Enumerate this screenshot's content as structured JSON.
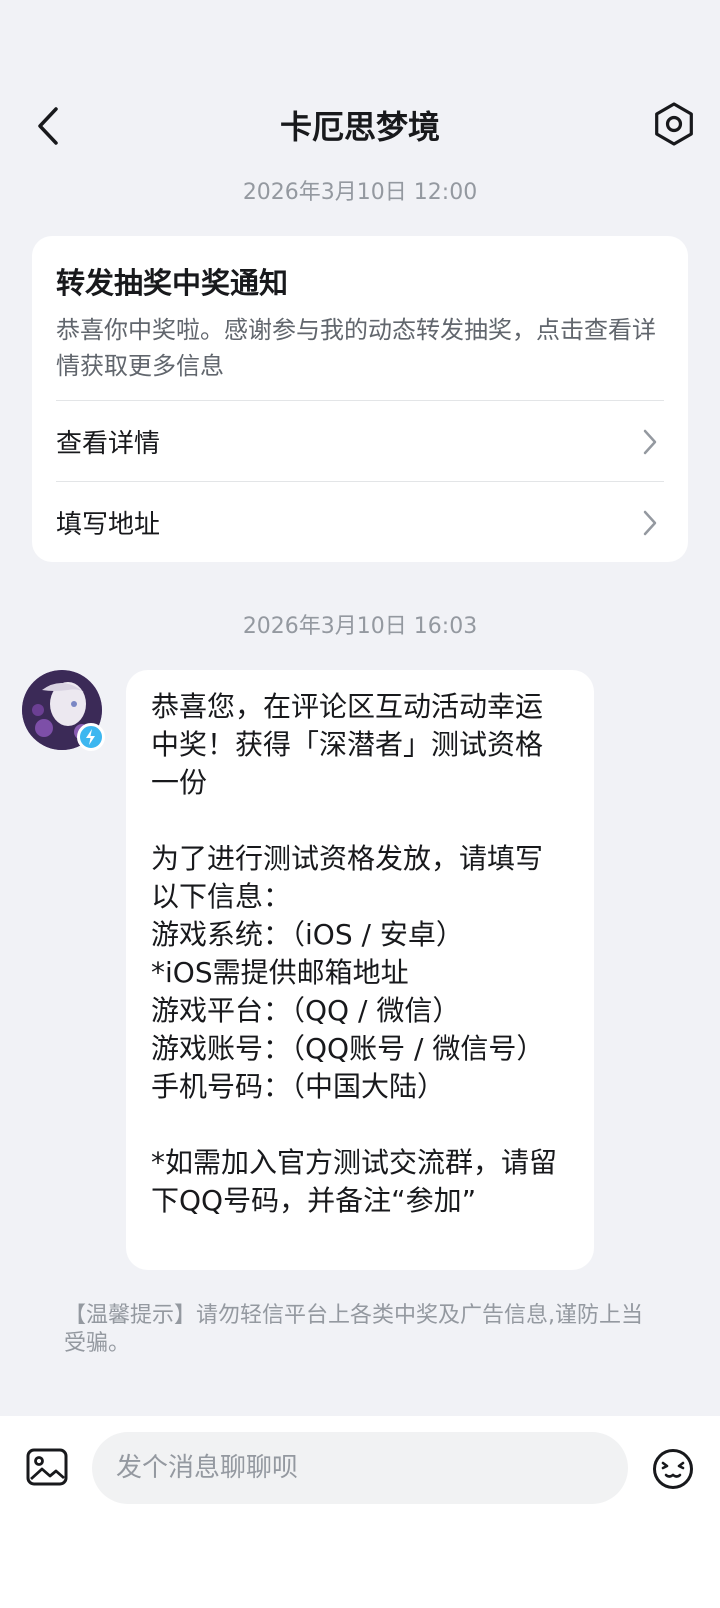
{
  "header": {
    "title": "卡厄思梦境"
  },
  "timestamps": [
    "2026年3月10日 12:00",
    "2026年3月10日 16:03"
  ],
  "card": {
    "title": "转发抽奖中奖通知",
    "description": "恭喜你中奖啦。感谢参与我的动态转发抽奖，点击查看详情获取更多信息",
    "rows": [
      {
        "label": "查看详情"
      },
      {
        "label": "填写地址"
      }
    ]
  },
  "message": {
    "text": "恭喜您，在评论区互动活动幸运中奖！获得「深潜者」测试资格一份\n\n为了进行测试资格发放，请填写以下信息：\n游戏系统：（iOS / 安卓）\n*iOS需提供邮箱地址\n游戏平台：（QQ / 微信）\n游戏账号：（QQ账号 / 微信号）\n手机号码：（中国大陆）\n\n*如需加入官方测试交流群，请留下QQ号码，并备注“参加”"
  },
  "warning": "【温馨提示】请勿轻信平台上各类中奖及广告信息,谨防上当受骗。",
  "input": {
    "placeholder": "发个消息聊聊呗"
  },
  "icons": {
    "back": "chevron-left-icon",
    "settings": "settings-hexagon-icon",
    "image": "image-icon",
    "emoji": "emoji-icon",
    "badge": "lightning-badge-icon"
  },
  "colors": {
    "background": "#f1f2f6",
    "card": "#ffffff",
    "badge": "#3db7f0",
    "muted_text": "#9499a0"
  }
}
